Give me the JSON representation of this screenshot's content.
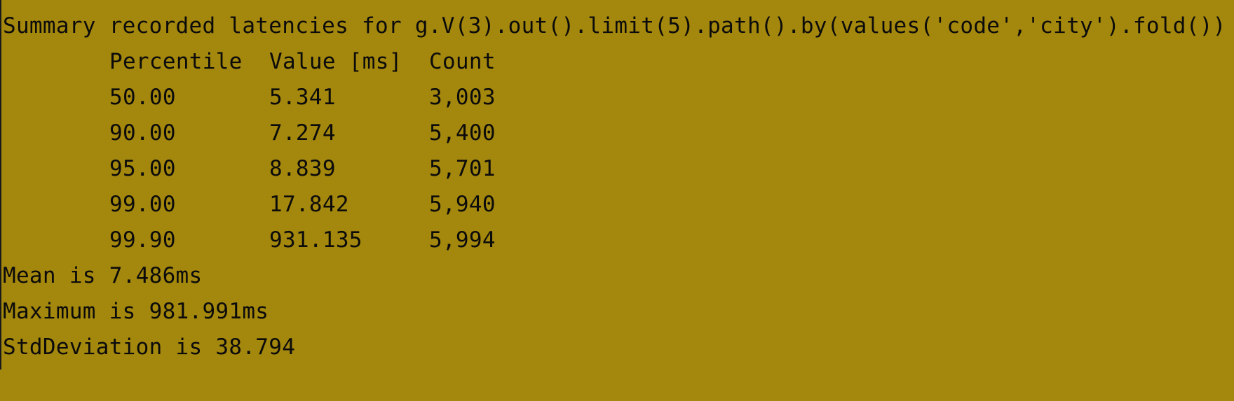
{
  "terminal": {
    "summary_line": "Summary recorded latencies for g.V(3).out().limit(5).path().by(values('code','city').fold())",
    "table": {
      "headers": [
        "Percentile",
        "Value [ms]",
        "Count"
      ],
      "rows": [
        [
          "50.00",
          "5.341",
          "3,003"
        ],
        [
          "90.00",
          "7.274",
          "5,400"
        ],
        [
          "95.00",
          "8.839",
          "5,701"
        ],
        [
          "99.00",
          "17.842",
          "5,940"
        ],
        [
          "99.90",
          "931.135",
          "5,994"
        ]
      ]
    },
    "mean_line": "Mean is 7.486ms",
    "maximum_line": "Maximum is 981.991ms",
    "stddev_line": "StdDeviation is 38.794"
  }
}
